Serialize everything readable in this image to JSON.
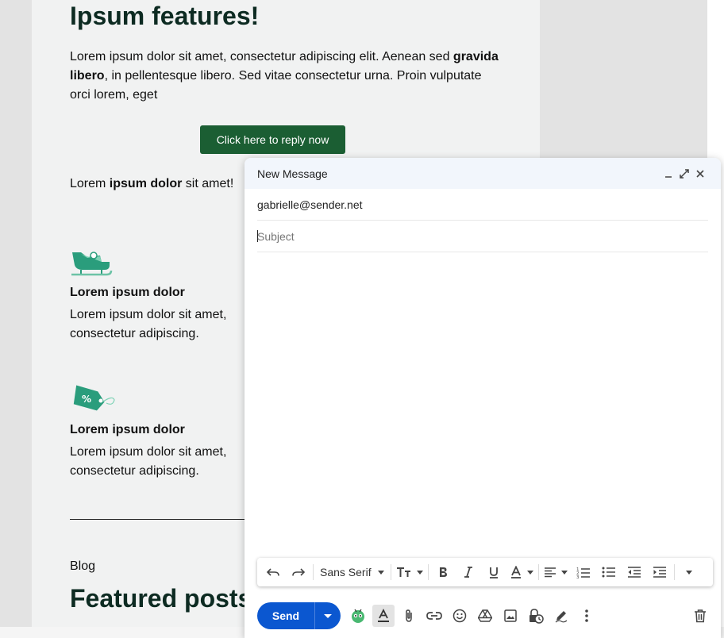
{
  "email": {
    "heading": "Ipsum features!",
    "intro_1": "Lorem ipsum dolor sit amet, consectetur adipiscing elit. Aenean sed ",
    "intro_bold": "gravida libero",
    "intro_2": ", in pellentesque libero. Sed vitae consectetur urna. Proin vulputate orci lorem, eget",
    "cta_label": "Click here to reply now",
    "line_1": "Lorem ",
    "line_bold": "ipsum dolor",
    "line_2": " sit amet!",
    "features": [
      {
        "icon": "sled-icon",
        "title": "Lorem ipsum dolor",
        "text": "Lorem ipsum dolor sit amet, consectetur adipiscing."
      },
      {
        "icon": "discount-tag-icon",
        "title": "Lorem ipsum dolor",
        "text": "Lorem ipsum dolor sit amet, consectetur adipiscing."
      }
    ],
    "blog_label": "Blog",
    "blog_heading": "Featured posts"
  },
  "compose": {
    "title": "New Message",
    "to": "gabrielle@sender.net",
    "subject_placeholder": "Subject",
    "subject_value": "",
    "font": "Sans Serif",
    "send_label": "Send"
  },
  "colors": {
    "cta_bg": "#1b5e33",
    "send_bg": "#0b57d0",
    "header_bg": "#f2f6fc",
    "email_bg": "#f1f2f2",
    "feature_icon": "#2a9d7c"
  }
}
